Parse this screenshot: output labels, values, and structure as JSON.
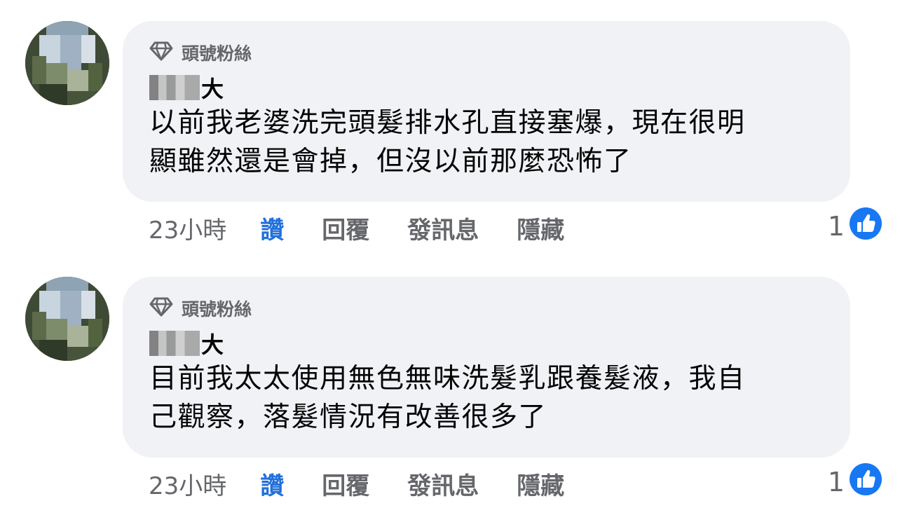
{
  "comments": [
    {
      "badge": "頭號粉絲",
      "author_suffix": "大",
      "text_lines": [
        "以前我老婆洗完頭髮排水孔直接塞爆，現在很明",
        "顯雖然還是會掉，但沒以前那麼恐怖了"
      ],
      "time": "23小時",
      "actions": {
        "like": "讚",
        "reply": "回覆",
        "message": "發訊息",
        "hide": "隱藏"
      },
      "reaction_count": "1",
      "reaction_icon": "thumbs-up-icon"
    },
    {
      "badge": "頭號粉絲",
      "author_suffix": "大",
      "text_lines": [
        "目前我太太使用無色無味洗髮乳跟養髮液，我自",
        "己觀察，落髮情況有改善很多了"
      ],
      "time": "23小時",
      "actions": {
        "like": "讚",
        "reply": "回覆",
        "message": "發訊息",
        "hide": "隱藏"
      },
      "reaction_count": "1",
      "reaction_icon": "thumbs-up-icon"
    }
  ],
  "colors": {
    "bubble": "#f0f2f5",
    "muted": "#65676b",
    "like_active": "#216fdb",
    "reaction_blue": "#1877f2"
  }
}
